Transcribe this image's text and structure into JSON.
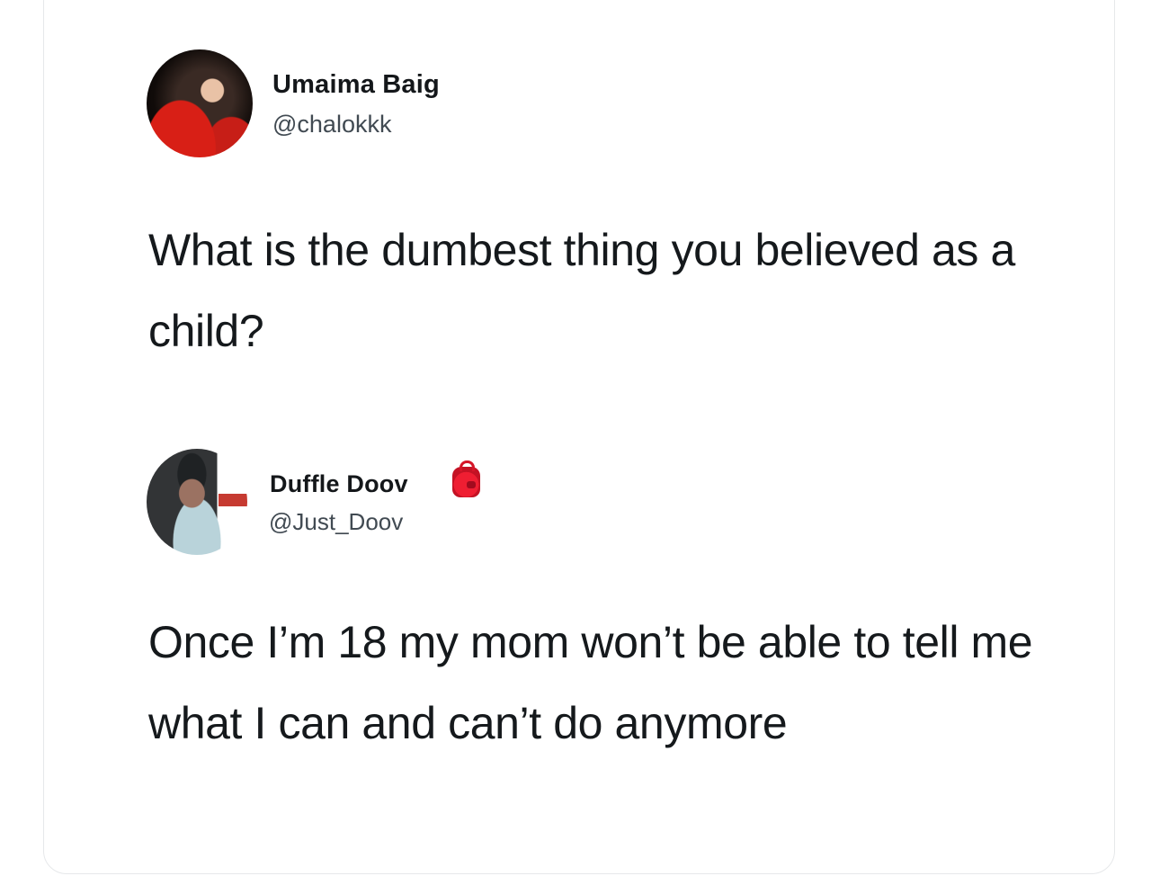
{
  "tweets": [
    {
      "author": {
        "name": "Umaima Baig",
        "handle": "@chalokkk"
      },
      "text": "What is the dumbest thing you believed as a child?"
    },
    {
      "author": {
        "name": "Duffle Doov",
        "handle": "@Just_Doov",
        "emoji_icon": "red-backpack-icon"
      },
      "text": "Once I’m 18 my mom won’t be able to tell me what I can and can’t do anymore"
    }
  ],
  "colors": {
    "background": "#ffffff",
    "text": "#14171a",
    "secondary_text": "#414a52",
    "border": "#e6e8ea"
  }
}
